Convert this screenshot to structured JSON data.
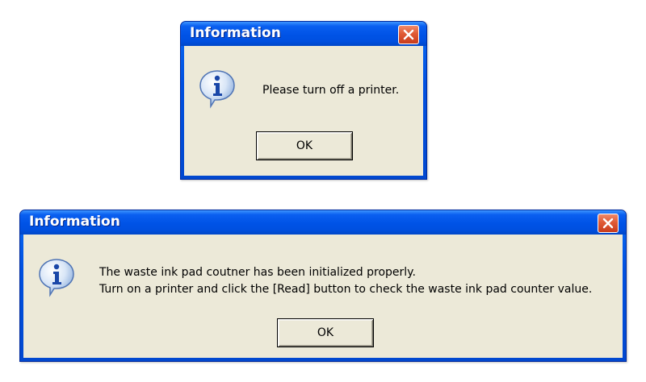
{
  "dialogs": [
    {
      "title": "Information",
      "icon": "info-icon",
      "message_lines": [
        "Please turn off a printer."
      ],
      "ok_label": "OK"
    },
    {
      "title": "Information",
      "icon": "info-icon",
      "message_lines": [
        "The waste ink pad coutner has been initialized properly.",
        "Turn on a printer and click the [Read] button to check the waste ink pad counter value."
      ],
      "ok_label": "OK"
    }
  ],
  "colors": {
    "titlebar": "#0053e6",
    "client_bg": "#ece9d8",
    "close_button": "#e05a35"
  }
}
